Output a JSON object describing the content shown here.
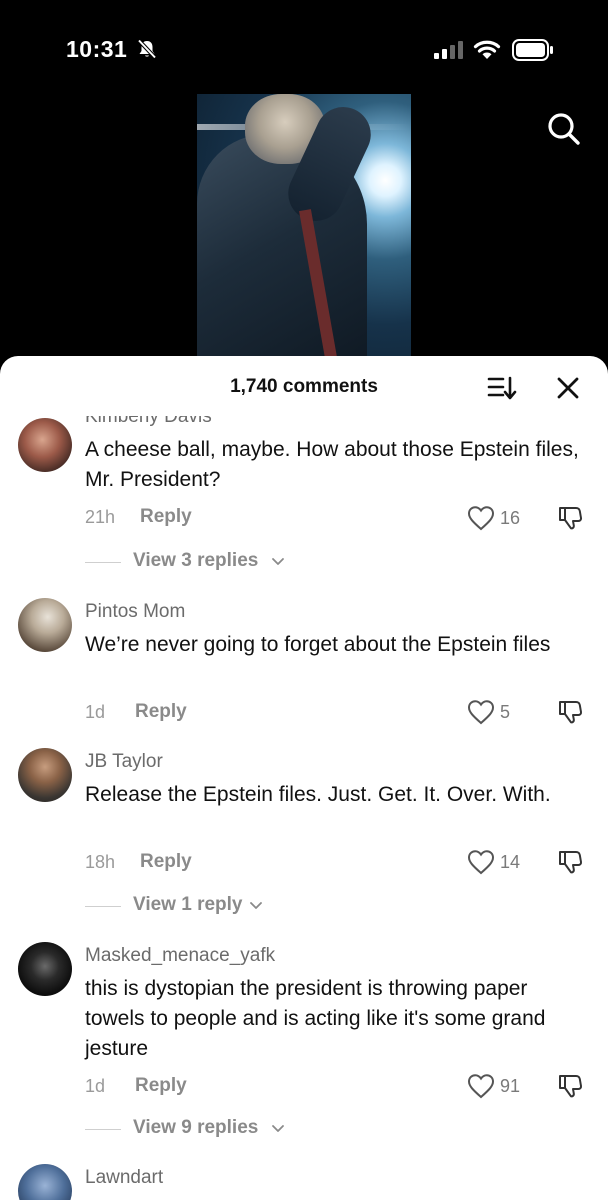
{
  "status_bar": {
    "time": "10:31"
  },
  "sheet": {
    "comment_count": "1,740 comments"
  },
  "comments": [
    {
      "username": "Kimberly Davis",
      "text": "A cheese ball, maybe. How about those Epstein files, Mr. President?",
      "time": "21h",
      "reply_label": "Reply",
      "likes": "16",
      "view_replies": "View 3 replies"
    },
    {
      "username": "Pintos Mom",
      "text": "We’re never going to forget about the Epstein files",
      "time": "1d",
      "reply_label": "Reply",
      "likes": "5"
    },
    {
      "username": "JB Taylor",
      "text": "Release the Epstein files. Just. Get. It. Over. With.",
      "time": "18h",
      "reply_label": "Reply",
      "likes": "14",
      "view_replies": "View 1 reply"
    },
    {
      "username": "Masked_menace_yafk",
      "text": "this is dystopian the president is throwing paper towels to people and is acting like it's some grand jesture",
      "time": "1d",
      "reply_label": "Reply",
      "likes": "91",
      "view_replies": "View 9 replies"
    },
    {
      "username": "Lawndart"
    }
  ],
  "colors": {
    "sheet_bg": "#ffffff",
    "text_primary": "#111111",
    "text_secondary": "#8a8a8a"
  },
  "icons": [
    "bell-slash-icon",
    "cellular-signal-icon",
    "wifi-icon",
    "battery-icon",
    "search-icon",
    "sort-icon",
    "close-icon",
    "heart-icon",
    "dislike-icon",
    "chevron-down-icon"
  ]
}
